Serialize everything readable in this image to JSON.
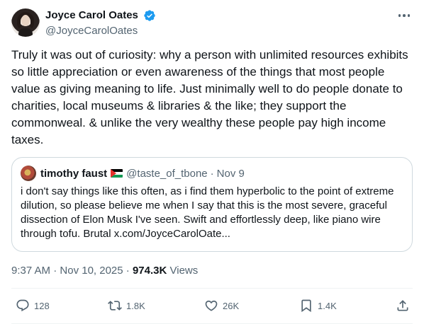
{
  "author": {
    "display_name": "Joyce Carol Oates",
    "handle": "@JoyceCarolOates",
    "verified": true,
    "verified_color": "#1d9bf0"
  },
  "tweet": {
    "text": "Truly it was out of curiosity: why a person with unlimited resources exhibits so little appreciation or even awareness of the things that most people value as giving meaning to life. Just minimally well to do people donate to charities, local museums & libraries & the like; they support the commonweal. & unlike the very wealthy these people pay high income taxes.",
    "time": "9:37 AM",
    "separator": "·",
    "date": "Nov 10, 2025",
    "views_count": "974.3K",
    "views_label": "Views"
  },
  "quoted_tweet": {
    "display_name": "timothy faust",
    "flag_icon": "palestine-flag-icon",
    "handle": "@taste_of_tbone",
    "separator": "·",
    "date": "Nov 9",
    "text": "i don't say things like this often, as i find them hyperbolic to the point of extreme dilution, so please believe me when I say that this is the most severe, graceful dissection of Elon Musk I've seen. Swift and effortlessly deep, like piano wire through tofu. Brutal x.com/JoyceCarolOate..."
  },
  "actions": {
    "reply_count": "128",
    "retweet_count": "1.8K",
    "like_count": "26K",
    "bookmark_count": "1.4K",
    "icons": [
      "reply-icon",
      "retweet-icon",
      "like-icon",
      "bookmark-icon",
      "share-icon"
    ]
  },
  "colors": {
    "text_primary": "#0f1419",
    "text_secondary": "#536471",
    "border": "#cfd9de"
  }
}
